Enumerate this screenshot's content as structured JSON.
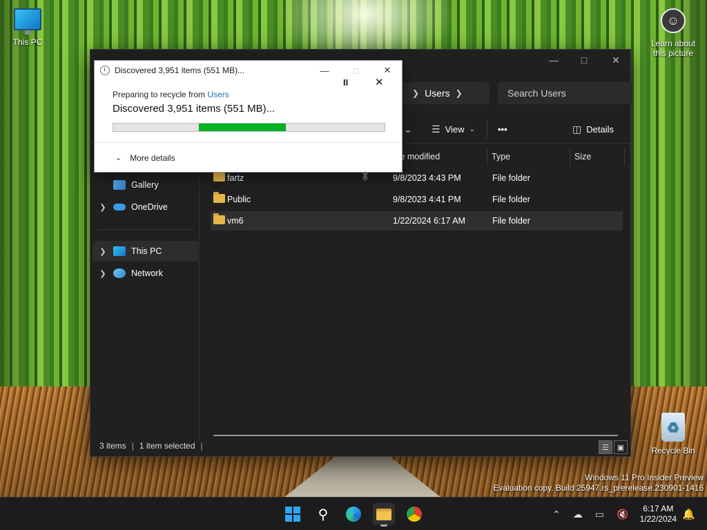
{
  "desktop": {
    "this_pc_label": "This PC",
    "recycle_bin_label": "Recycle Bin",
    "learn_label_line1": "Learn about",
    "learn_label_line2": "this picture",
    "watermark_line1": "Windows 11 Pro Insider Preview",
    "watermark_line2": "Evaluation copy. Build 25947.rs_prerelease.230901-1416"
  },
  "explorer": {
    "address_crumb": "Users",
    "search_placeholder": "Search Users",
    "toolbar": {
      "view_label": "View",
      "more_label": "•••",
      "details_label": "Details"
    },
    "sidebar": {
      "gallery": "Gallery",
      "onedrive": "OneDrive",
      "this_pc": "This PC",
      "network": "Network"
    },
    "columns": {
      "date_modified": "te modified",
      "type": "Type",
      "size": "Size"
    },
    "rows": [
      {
        "name": "fartz",
        "date": "9/8/2023 4:43 PM",
        "type": "File folder"
      },
      {
        "name": "Public",
        "date": "9/8/2023 4:41 PM",
        "type": "File folder"
      },
      {
        "name": "vm6",
        "date": "1/22/2024 6:17 AM",
        "type": "File folder"
      }
    ],
    "status": {
      "items": "3 items",
      "selected": "1 item selected"
    }
  },
  "dialog": {
    "title": "Discovered 3,951 items (551 MB)...",
    "from_prefix": "Preparing to recycle from ",
    "from_location": "Users",
    "main_text": "Discovered 3,951 items (551 MB)...",
    "pause_glyph": "II",
    "more_details": "More details",
    "progress_start": 0.315,
    "progress_end": 0.635
  },
  "taskbar": {
    "time": "6:17 AM",
    "date": "1/22/2024"
  },
  "colors": {
    "progress_green": "#06b025",
    "explorer_bg": "#202020",
    "link_blue": "#1f6fbf",
    "start_blue": "#2fa6f3"
  },
  "icons": [
    "monitor-icon",
    "recycle-bin-icon",
    "learn-about-picture-icon",
    "gallery-icon",
    "onedrive-icon",
    "network-icon",
    "folder-icon",
    "search-icon",
    "edge-icon",
    "file-explorer-icon",
    "chrome-icon",
    "chevron-up-icon",
    "onedrive-tray-icon",
    "network-tray-icon",
    "volume-muted-icon",
    "notification-bell-icon"
  ]
}
